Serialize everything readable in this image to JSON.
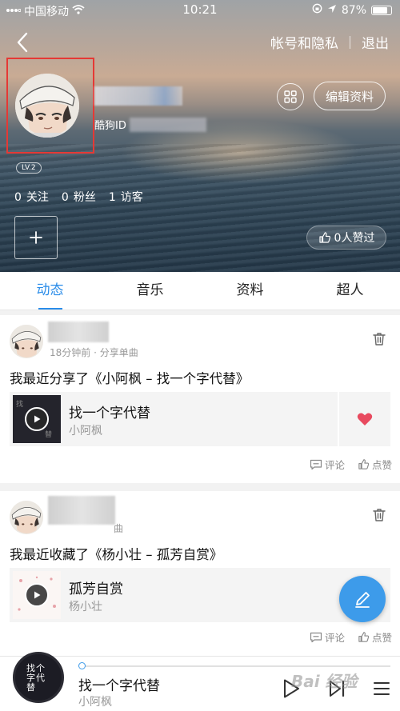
{
  "status_bar": {
    "carrier": "中国移动",
    "time": "10:21",
    "battery": "87%",
    "battery_level": 0.87
  },
  "nav": {
    "account_privacy": "帐号和隐私",
    "logout": "退出"
  },
  "profile": {
    "kugou_id_label": "酷狗ID",
    "edit_label": "编辑资料",
    "level": "LV.2",
    "stats": [
      {
        "num": "0",
        "label": "关注"
      },
      {
        "num": "0",
        "label": "粉丝"
      },
      {
        "num": "1",
        "label": "访客"
      }
    ],
    "likes": "0人赞过"
  },
  "tabs": [
    {
      "label": "动态",
      "active": true
    },
    {
      "label": "音乐",
      "active": false
    },
    {
      "label": "资料",
      "active": false
    },
    {
      "label": "超人",
      "active": false
    }
  ],
  "feed": [
    {
      "meta": "18分钟前 · 分享单曲",
      "text": "我最近分享了《小阿枫 – 找一个字代替》",
      "song_title": "找一个字代替",
      "song_artist": "小阿枫",
      "liked": true,
      "comment_label": "评论",
      "like_label": "点赞"
    },
    {
      "meta": "曲",
      "text": "我最近收藏了《杨小壮 – 孤芳自赏》",
      "song_title": "孤芳自赏",
      "song_artist": "杨小壮",
      "liked": false,
      "comment_label": "评论",
      "like_label": "点赞"
    }
  ],
  "player": {
    "cover_text": "找个字代替",
    "title": "找一个字代替",
    "artist": "小阿枫",
    "progress": 0.0
  },
  "watermark": "Bai 经验",
  "colors": {
    "accent": "#2a8ce9",
    "fab": "#3d9bea",
    "heart": "#e84a5f",
    "highlight_box": "#e53935"
  },
  "icons": [
    "back-icon",
    "wifi-icon",
    "signal-icon",
    "location-icon",
    "qr-code-icon",
    "plus-icon",
    "thumbs-up-icon",
    "delete-icon",
    "play-icon",
    "heart-icon",
    "comment-icon",
    "pencil-icon",
    "next-icon",
    "playlist-icon"
  ]
}
